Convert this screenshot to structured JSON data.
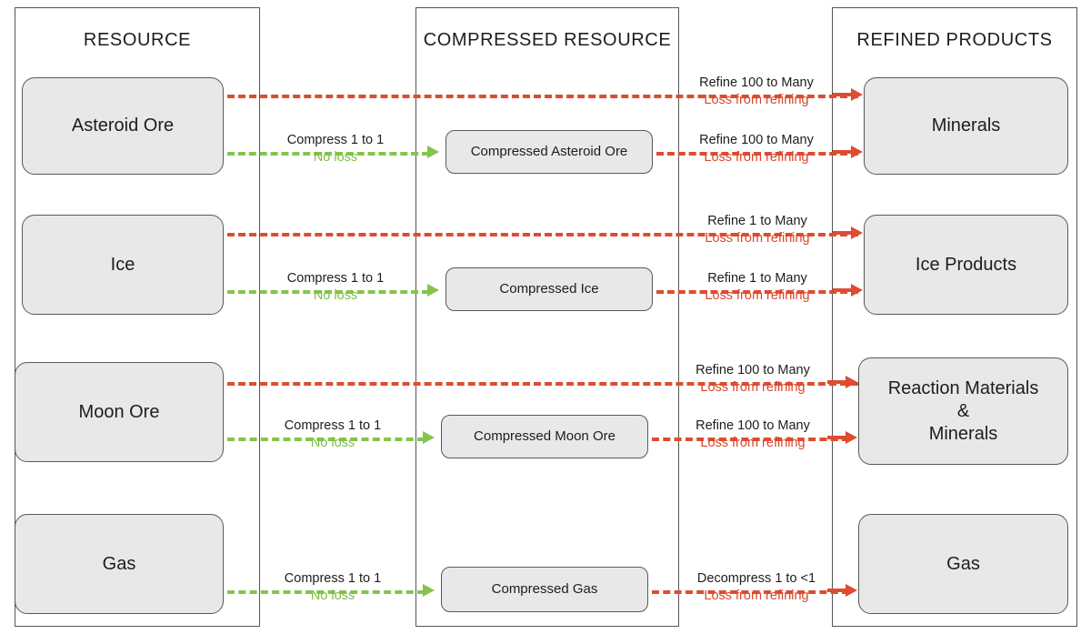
{
  "columns": [
    {
      "id": "resource",
      "title": "RESOURCE"
    },
    {
      "id": "compressed",
      "title": "COMPRESSED RESOURCE"
    },
    {
      "id": "refined",
      "title": "REFINED PRODUCTS"
    }
  ],
  "colors": {
    "loss_red": "#de4c30",
    "no_loss_green": "#84c44a",
    "node_fill": "#e8e8e8",
    "node_border": "#595959",
    "frame_border": "#555555"
  },
  "nodes": {
    "resources": [
      {
        "id": "asteroid-ore",
        "label": "Asteroid Ore"
      },
      {
        "id": "ice",
        "label": "Ice"
      },
      {
        "id": "moon-ore",
        "label": "Moon Ore"
      },
      {
        "id": "gas",
        "label": "Gas"
      }
    ],
    "compressed": [
      {
        "id": "compressed-asteroid-ore",
        "label": "Compressed Asteroid Ore"
      },
      {
        "id": "compressed-ice",
        "label": "Compressed Ice"
      },
      {
        "id": "compressed-moon-ore",
        "label": "Compressed Moon Ore"
      },
      {
        "id": "compressed-gas",
        "label": "Compressed Gas"
      }
    ],
    "refined": [
      {
        "id": "minerals",
        "label": "Minerals"
      },
      {
        "id": "ice-products",
        "label": "Ice Products"
      },
      {
        "id": "reaction-materials",
        "label": "Reaction Materials\n&\nMinerals"
      },
      {
        "id": "gas-refined",
        "label": "Gas"
      }
    ]
  },
  "edges": {
    "compress": [
      {
        "id": "compress-asteroid-ore",
        "top": "Compress 1 to 1",
        "bottom": "No loss"
      },
      {
        "id": "compress-ice",
        "top": "Compress 1 to 1",
        "bottom": "No loss"
      },
      {
        "id": "compress-moon-ore",
        "top": "Compress 1 to 1",
        "bottom": "No loss"
      },
      {
        "id": "compress-gas",
        "top": "Compress 1 to 1",
        "bottom": "No loss"
      }
    ],
    "refine": [
      {
        "id": "refine-asteroid-ore",
        "top": "Refine 100 to Many",
        "bottom": "Loss from refining"
      },
      {
        "id": "refine-compressed-asteroid-ore",
        "top": "Refine 100 to Many",
        "bottom": "Loss from refining"
      },
      {
        "id": "refine-ice",
        "top": "Refine 1 to Many",
        "bottom": "Loss from refining"
      },
      {
        "id": "refine-compressed-ice",
        "top": "Refine 1 to Many",
        "bottom": "Loss from refining"
      },
      {
        "id": "refine-moon-ore",
        "top": "Refine 100 to Many",
        "bottom": "Loss from refining"
      },
      {
        "id": "refine-compressed-moon-ore",
        "top": "Refine 100 to Many",
        "bottom": "Loss from refining"
      },
      {
        "id": "decompress-compressed-gas",
        "top": "Decompress 1 to <1",
        "bottom": "Loss from refining"
      }
    ]
  }
}
